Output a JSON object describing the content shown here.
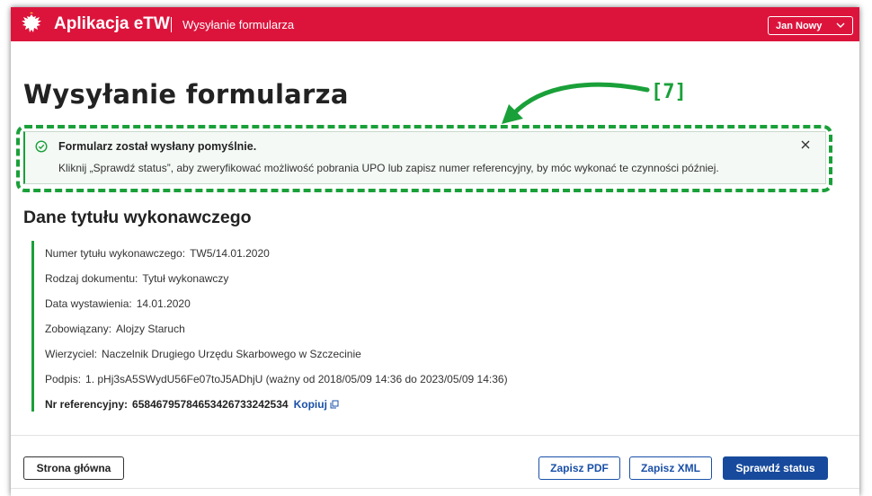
{
  "header": {
    "app_title": "Aplikacja eTW",
    "subtitle": "Wysyłanie formularza",
    "user_name": "Jan Nowy",
    "bg_color": "#dc143c"
  },
  "page": {
    "title": "Wysyłanie formularza",
    "annotation_label": "[7]"
  },
  "alert": {
    "title": "Formularz został wysłany pomyślnie.",
    "text": "Kliknij „Sprawdź status”, aby zweryfikować możliwość pobrania UPO lub zapisz numer referencyjny, by móc wykonać te czynności później.",
    "icon": "check-circle-icon",
    "close_icon": "close-icon",
    "accent": "#1aa039"
  },
  "section": {
    "title": "Dane tytułu wykonawczego",
    "rows": [
      {
        "label": "Numer tytułu wykonawczego:",
        "value": "TW5/14.01.2020"
      },
      {
        "label": "Rodzaj dokumentu:",
        "value": "Tytuł wykonawczy"
      },
      {
        "label": "Data wystawienia:",
        "value": "14.01.2020"
      },
      {
        "label": "Zobowiązany:",
        "value": "Alojzy Staruch"
      },
      {
        "label": "Wierzyciel:",
        "value": "Naczelnik Drugiego Urzędu Skarbowego w Szczecinie"
      },
      {
        "label": "Podpis:",
        "value": "1. pHj3sA5SWydU56Fe07toJ5ADhjU (ważny od 2018/05/09 14:36 do 2023/05/09 14:36)"
      }
    ],
    "reference": {
      "label": "Nr referencyjny:",
      "value": "65846795784653426733242534",
      "copy_label": "Kopiuj"
    }
  },
  "footer": {
    "home_label": "Strona główna",
    "save_pdf_label": "Zapisz PDF",
    "save_xml_label": "Zapisz XML",
    "check_status_label": "Sprawdź status",
    "primary_color": "#174a9c"
  }
}
